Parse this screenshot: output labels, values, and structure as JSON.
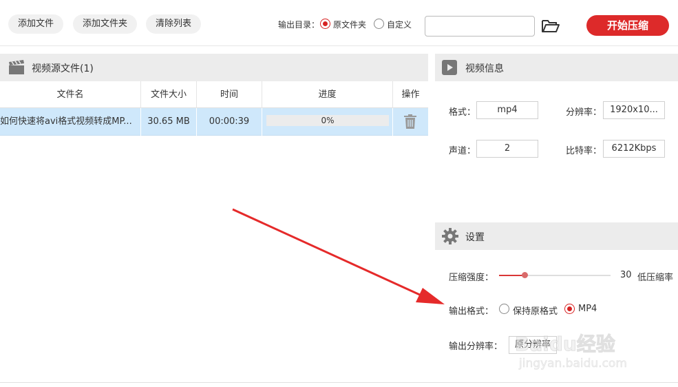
{
  "toolbar": {
    "add_file": "添加文件",
    "add_folder": "添加文件夹",
    "clear_list": "清除列表",
    "output_dir_label": "输出目录：",
    "option_source_folder": "原文件夹",
    "option_custom": "自定义",
    "output_path_value": "",
    "folder_icon": "folder-open-icon",
    "start_button": "开始压缩"
  },
  "source_panel": {
    "title": "视频源文件(1)",
    "icon": "clapperboard-icon",
    "columns": [
      "文件名",
      "文件大小",
      "时间",
      "进度",
      "操作"
    ],
    "rows": [
      {
        "file_name": "如何快速将avi格式视频转成MP...",
        "file_size": "30.65 MB",
        "duration": "00:00:39",
        "progress_text": "0%",
        "progress": 0,
        "action_icon": "trash-icon"
      }
    ]
  },
  "video_info": {
    "title": "视频信息",
    "icon": "play-icon",
    "format_label": "格式：",
    "format_value": "mp4",
    "resolution_label": "分辨率：",
    "resolution_value": "1920x10...",
    "channel_label": "声道：",
    "channel_value": "2",
    "bitrate_label": "比特率：",
    "bitrate_value": "6212Kbps"
  },
  "settings": {
    "title": "设置",
    "icon": "gear-icon",
    "strength_label": "压缩强度：",
    "strength_value": "30",
    "strength_fraction": 0.23,
    "strength_desc": "低压缩率",
    "output_format_label": "输出格式：",
    "format_option_keep": "保持原格式",
    "format_option_mp4": "MP4",
    "output_resolution_label": "输出分辨率：",
    "output_resolution_value": "原分辨率"
  },
  "watermark": {
    "logo": "Baidu经验",
    "url": "jingyan.baidu.com"
  },
  "colors": {
    "accent": "#dd2a2a",
    "row_selected": "#cfe8fb",
    "annotation_arrow": "#e52a2a"
  }
}
